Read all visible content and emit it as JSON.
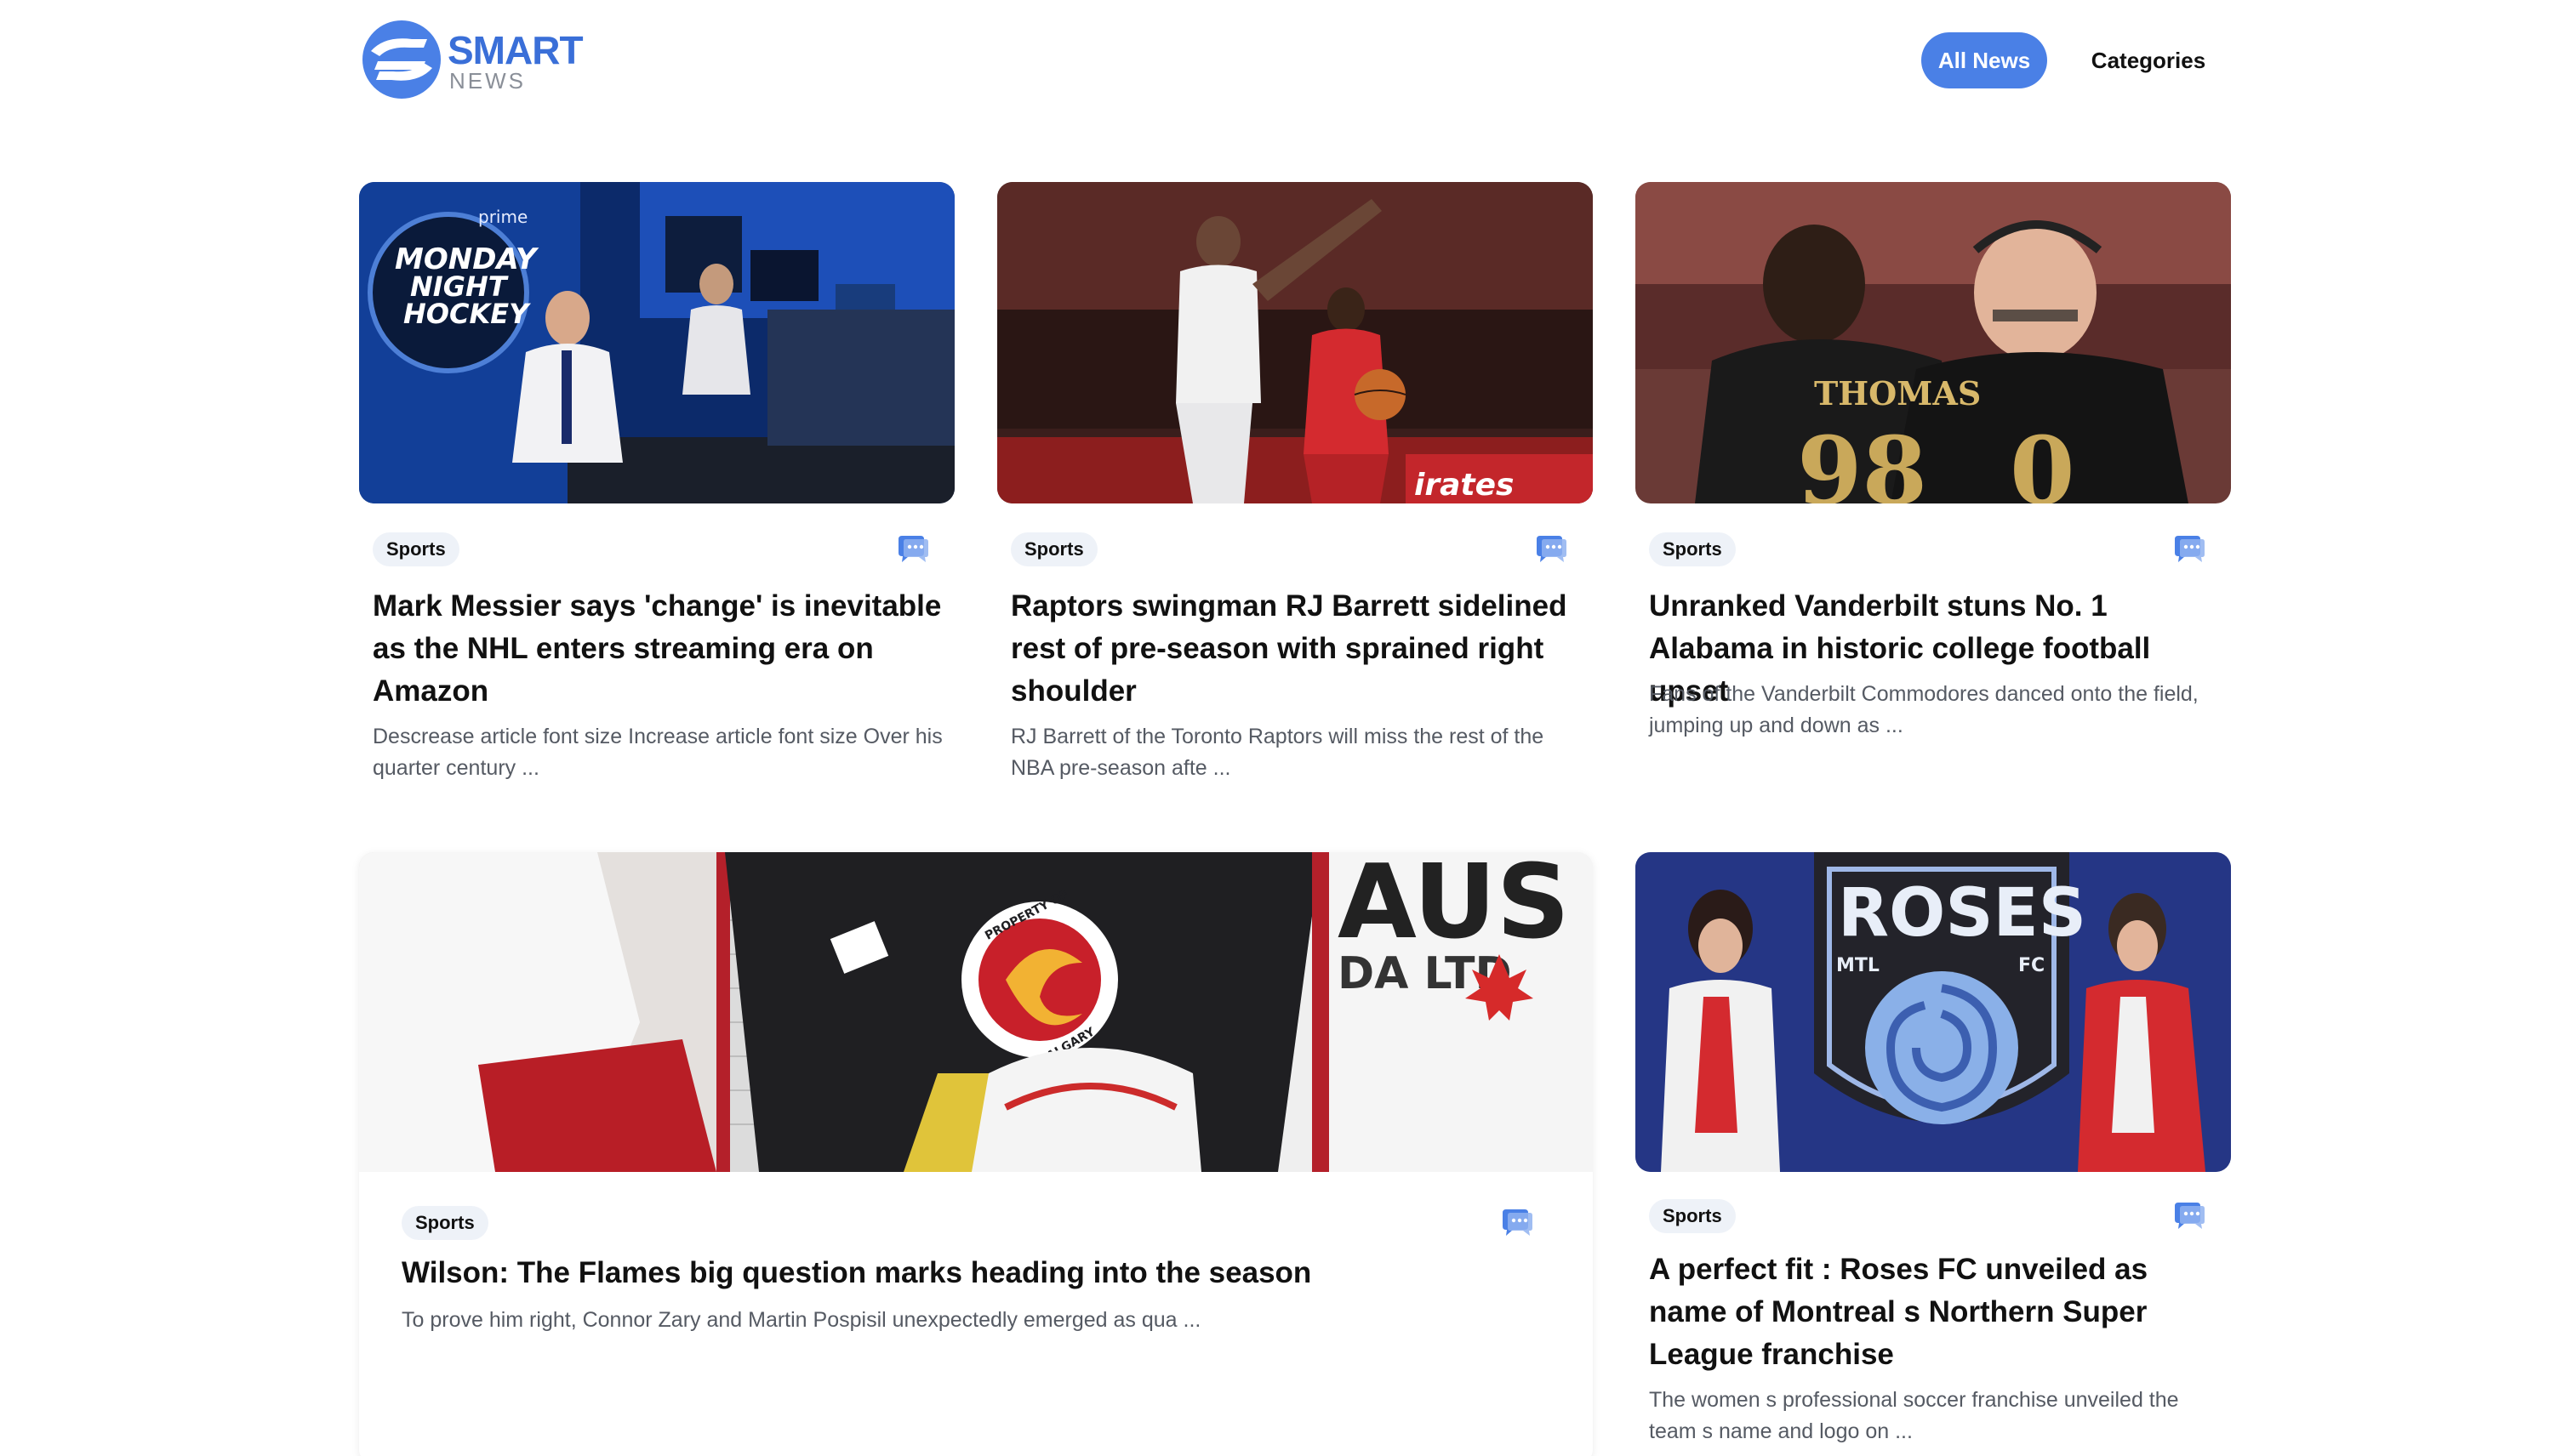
{
  "brand": {
    "name_primary": "SMART",
    "name_secondary": "NEWS",
    "accent_color": "#4a80e6"
  },
  "nav": {
    "all_news": "All News",
    "categories": "Categories"
  },
  "articles": [
    {
      "category": "Sports",
      "title": "Mark Messier says 'change' is inevitable as the NHL enters streaming era on Amazon",
      "excerpt": "Descrease article font size Increase article font size Over his quarter century ...",
      "image_icon": "photo-hockey-broadcast-booth",
      "image_text": [
        "prime",
        "MONDAY",
        "NIGHT",
        "HOCKEY"
      ]
    },
    {
      "category": "Sports",
      "title": "Raptors swingman RJ Barrett sidelined rest of pre-season with sprained right shoulder",
      "excerpt": "RJ Barrett of the Toronto Raptors will miss the rest of the NBA pre-season afte ...",
      "image_icon": "photo-basketball-game",
      "image_text": [
        "irates"
      ]
    },
    {
      "category": "Sports",
      "title": "Unranked Vanderbilt stuns No. 1 Alabama in historic college football upset",
      "excerpt": "Fans of the Vanderbilt Commodores danced onto the field, jumping up and down as ...",
      "image_icon": "photo-football-players",
      "image_text": [
        "THOMAS"
      ]
    },
    {
      "category": "Sports",
      "title": "Wilson: The Flames big question marks heading into the season",
      "excerpt": "To prove him right, Connor Zary and Martin Pospisil unexpectedly emerged as qua ...",
      "image_icon": "photo-hockey-goalie",
      "image_text": [
        "AUS",
        "DA LTD",
        "PROPERTY OF",
        "CALGARY"
      ]
    },
    {
      "category": "Sports",
      "title": "A perfect fit : Roses FC unveiled as name of Montreal s Northern Super League franchise",
      "excerpt": "The women s professional soccer franchise unveiled the team s name and logo on ...",
      "image_icon": "photo-roses-fc-unveiling",
      "image_text": [
        "ROSES",
        "MTL",
        "FC"
      ]
    }
  ]
}
